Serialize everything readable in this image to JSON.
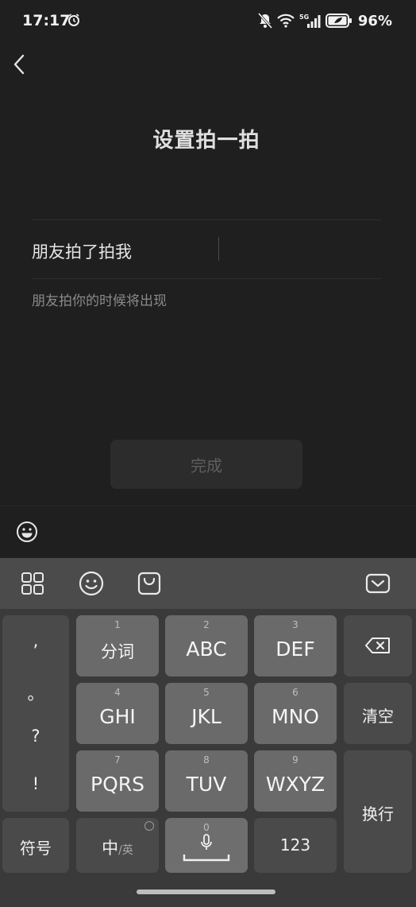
{
  "status": {
    "time": "17:17",
    "battery": "96%",
    "network": "5G"
  },
  "header": {
    "title": "设置拍一拍"
  },
  "form": {
    "input_prefix": "朋友拍了拍我",
    "input_value": "",
    "hint": "朋友拍你的时候将出现",
    "done_label": "完成"
  },
  "keyboard": {
    "punctuation": [
      ",",
      "。",
      "?",
      "!"
    ],
    "keys": [
      {
        "num": "1",
        "label": "分词"
      },
      {
        "num": "2",
        "label": "ABC"
      },
      {
        "num": "3",
        "label": "DEF"
      },
      {
        "num": "4",
        "label": "GHI"
      },
      {
        "num": "5",
        "label": "JKL"
      },
      {
        "num": "6",
        "label": "MNO"
      },
      {
        "num": "7",
        "label": "PQRS"
      },
      {
        "num": "8",
        "label": "TUV"
      },
      {
        "num": "9",
        "label": "WXYZ"
      }
    ],
    "clear_label": "清空",
    "newline_label": "换行",
    "symbols_label": "符号",
    "lang_main": "中",
    "lang_alt": "/英",
    "space_num": "0",
    "numbers_label": "123"
  },
  "colors": {
    "background": "#1f1f1f",
    "keyboard": "#3a3a3a",
    "key": "#6a6a6a",
    "key_dark": "#4a4a4a"
  },
  "icons": [
    "alarm-icon",
    "mute-icon",
    "wifi-icon",
    "signal-icon",
    "battery-icon",
    "back-icon",
    "emoji-icon",
    "grid-icon",
    "smiley-icon",
    "bag-icon",
    "collapse-keyboard-icon",
    "backspace-icon",
    "microphone-icon"
  ]
}
